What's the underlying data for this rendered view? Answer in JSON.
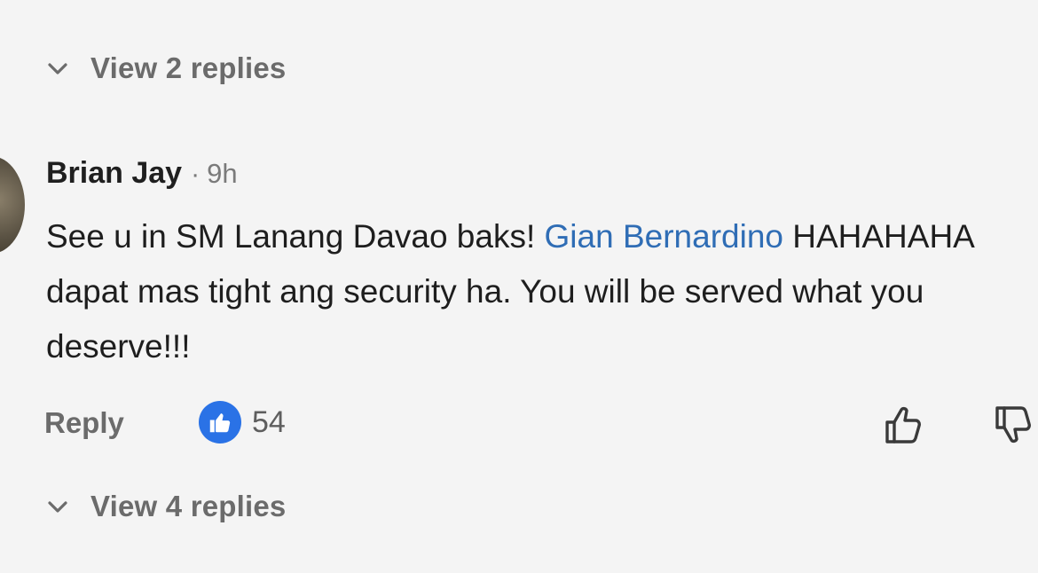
{
  "top_thread": {
    "view_replies_label": "View 2 replies"
  },
  "comment": {
    "author": "Brian Jay",
    "separator": "·",
    "time": "9h",
    "text_part1": "See u in SM Lanang Davao baks! ",
    "mention": "Gian Bernardino",
    "text_part2": " HAHAHAHA dapat mas tight ang security ha. You will be served what you deserve!!!"
  },
  "actions": {
    "reply_label": "Reply",
    "reaction_count": "54",
    "reaction_icon": "like-badge-icon"
  },
  "bottom_thread": {
    "view_replies_label": "View 4 replies"
  },
  "colors": {
    "background": "#f4f4f4",
    "mention": "#2f6db5",
    "like_badge": "#2a72e6",
    "muted_text": "#6b6b6b"
  }
}
